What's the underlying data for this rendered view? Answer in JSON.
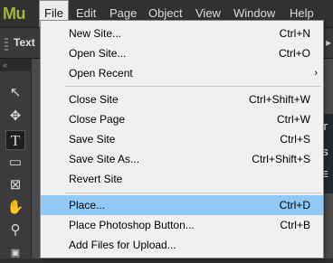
{
  "app": {
    "logo": "Mu"
  },
  "menubar": {
    "items": [
      "File",
      "Edit",
      "Page",
      "Object",
      "View",
      "Window",
      "Help"
    ]
  },
  "toolbar": {
    "label": "Text"
  },
  "tools_header": "«",
  "file_menu": {
    "groups": [
      [
        {
          "label": "New Site...",
          "shortcut": "Ctrl+N"
        },
        {
          "label": "Open Site...",
          "shortcut": "Ctrl+O"
        },
        {
          "label": "Open Recent",
          "shortcut": "",
          "submenu": true
        }
      ],
      [
        {
          "label": "Close Site",
          "shortcut": "Ctrl+Shift+W"
        },
        {
          "label": "Close Page",
          "shortcut": "Ctrl+W"
        },
        {
          "label": "Save Site",
          "shortcut": "Ctrl+S"
        },
        {
          "label": "Save Site As...",
          "shortcut": "Ctrl+Shift+S"
        },
        {
          "label": "Revert Site",
          "shortcut": ""
        }
      ],
      [
        {
          "label": "Place...",
          "shortcut": "Ctrl+D",
          "highlighted": true
        },
        {
          "label": "Place Photoshop Button...",
          "shortcut": "Ctrl+B"
        },
        {
          "label": "Add Files for Upload...",
          "shortcut": ""
        }
      ]
    ]
  },
  "canvas": {
    "snippets": [
      "T",
      "S",
      "E"
    ]
  },
  "colors": {
    "menubar_bg": "#313131",
    "menu_bg": "#f0f0f0",
    "highlight": "#91c9f7",
    "logo": "#9fb83a"
  }
}
